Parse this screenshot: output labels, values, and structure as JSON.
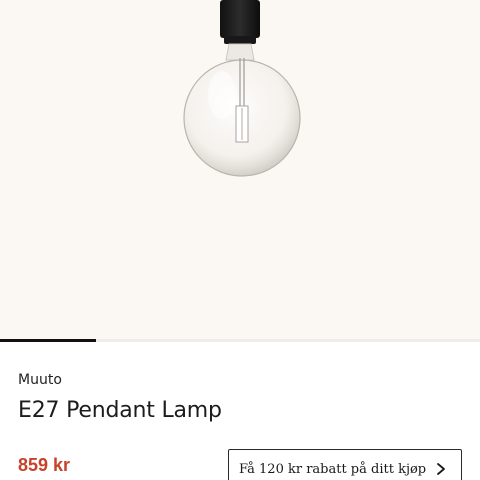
{
  "product": {
    "image_alt": "E27 Pendant Lamp product image",
    "gallery_progress": 0.2,
    "brand": "Muuto",
    "name": "E27 Pendant Lamp",
    "price": "859 kr"
  },
  "promo": {
    "label": "Få 120 kr rabatt på ditt kjøp",
    "icon": "chevron-right-icon"
  },
  "colors": {
    "price": "#c8412b",
    "hero_background": "#fbf8f3"
  }
}
